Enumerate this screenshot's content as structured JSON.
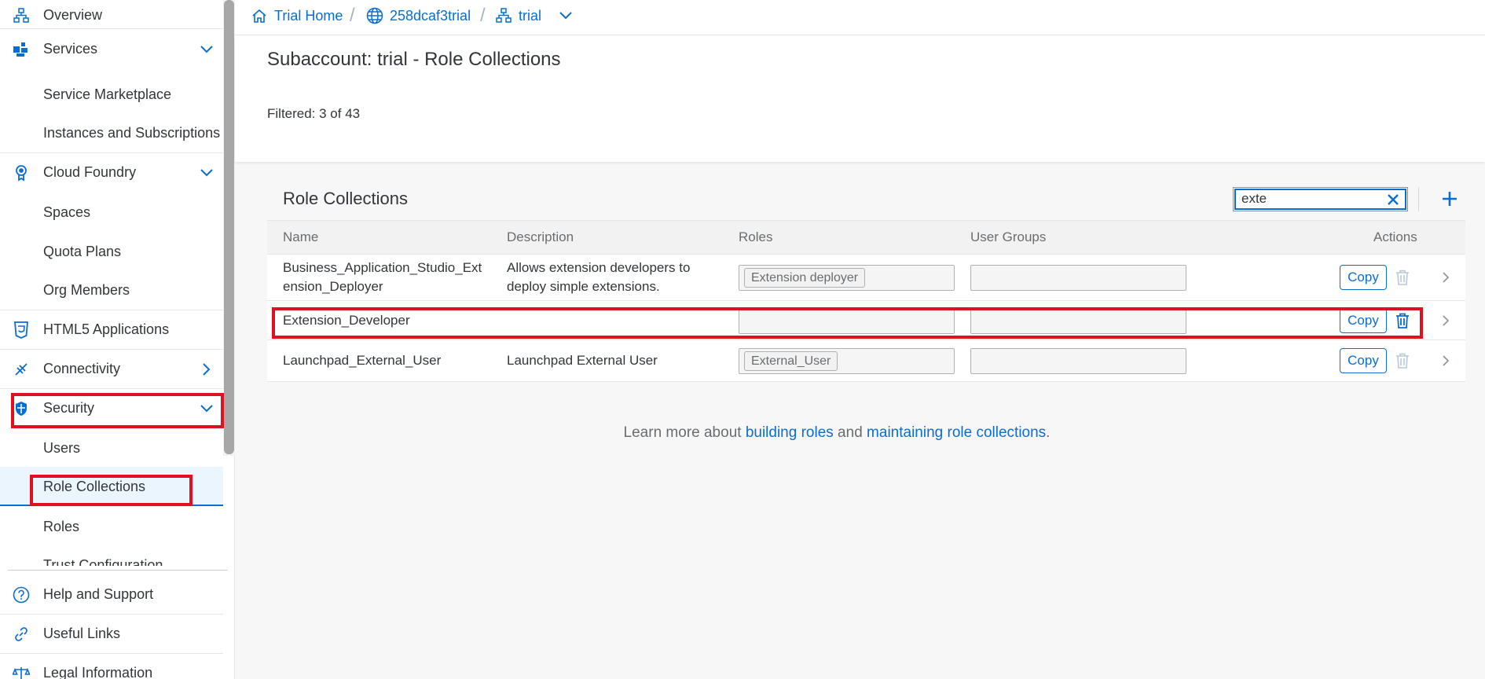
{
  "sidebar": {
    "items": [
      {
        "label": "Overview",
        "icon": "hierarchy-icon"
      },
      {
        "label": "Services",
        "icon": "services-icon",
        "expanded": true
      },
      {
        "label": "Service Marketplace"
      },
      {
        "label": "Instances and Subscriptions"
      },
      {
        "label": "Cloud Foundry",
        "icon": "cloud-foundry-icon",
        "expanded": true
      },
      {
        "label": "Spaces"
      },
      {
        "label": "Quota Plans"
      },
      {
        "label": "Org Members"
      },
      {
        "label": "HTML5 Applications",
        "icon": "html5-icon"
      },
      {
        "label": "Connectivity",
        "icon": "connectivity-icon",
        "expanded": false
      },
      {
        "label": "Security",
        "icon": "shield-icon",
        "expanded": true
      },
      {
        "label": "Users"
      },
      {
        "label": "Role Collections",
        "selected": true
      },
      {
        "label": "Roles"
      },
      {
        "label": "Trust Configuration"
      }
    ],
    "footer": [
      {
        "label": "Help and Support",
        "icon": "help-icon"
      },
      {
        "label": "Useful Links",
        "icon": "link-icon"
      },
      {
        "label": "Legal Information",
        "icon": "scale-icon"
      }
    ]
  },
  "breadcrumb": {
    "items": [
      {
        "label": "Trial Home",
        "icon": "home-icon"
      },
      {
        "label": "258dcaf3trial",
        "icon": "globe-icon"
      },
      {
        "label": "trial",
        "icon": "hierarchy-icon"
      }
    ]
  },
  "header": {
    "title": "Subaccount: trial - Role Collections",
    "filtered": "Filtered: 3 of 43"
  },
  "table": {
    "title": "Role Collections",
    "search_value": "exte",
    "columns": {
      "name": "Name",
      "description": "Description",
      "roles": "Roles",
      "user_groups": "User Groups",
      "actions": "Actions"
    },
    "rows": [
      {
        "name_line1": "Business_Application_Studio_Ext",
        "name_line2": "ension_Deployer",
        "description_line1": "Allows extension developers to",
        "description_line2": "deploy simple extensions.",
        "role": "Extension deployer",
        "copy": "Copy"
      },
      {
        "name": "Extension_Developer",
        "description": "",
        "role": "",
        "copy": "Copy"
      },
      {
        "name": "Launchpad_External_User",
        "description": "Launchpad External User",
        "role": "External_User",
        "copy": "Copy"
      }
    ]
  },
  "learn_more": {
    "prefix": "Learn more about ",
    "link1": "building roles",
    "middle": " and ",
    "link2": "maintaining role collections",
    "suffix": "."
  },
  "colors": {
    "accent": "#0a6ed1",
    "highlight": "#e01020"
  }
}
